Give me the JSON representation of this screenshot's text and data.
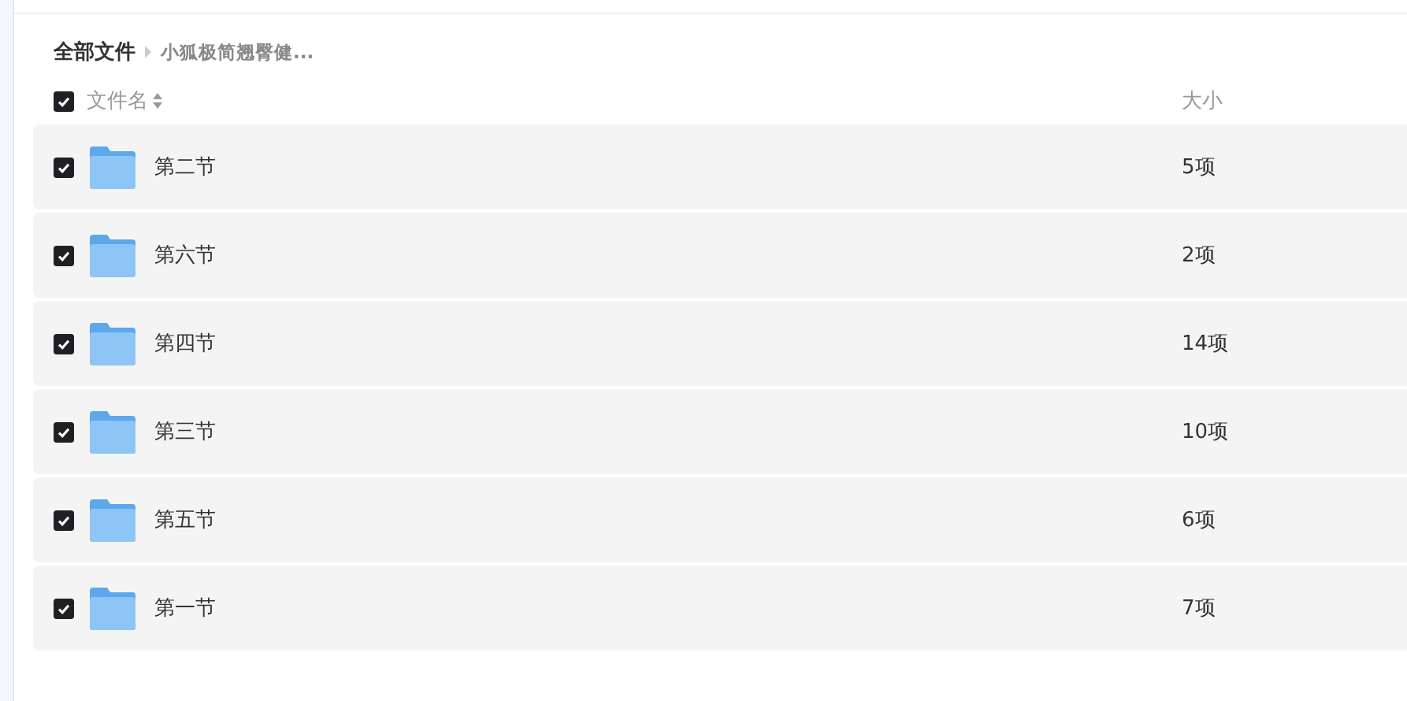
{
  "breadcrumb": [
    {
      "label": "全部文件",
      "kind": "root"
    },
    {
      "label": "小狐极简翘臀健...",
      "kind": "current"
    }
  ],
  "table": {
    "select_all": {
      "checked": true
    },
    "columns": [
      {
        "label": "文件名",
        "sortable": true
      },
      {
        "label": "大小",
        "sortable": false
      }
    ],
    "rows": [
      {
        "name": "第二节",
        "size": "5项",
        "selected": true
      },
      {
        "name": "第六节",
        "size": "2项",
        "selected": true
      },
      {
        "name": "第四节",
        "size": "14项",
        "selected": true
      },
      {
        "name": "第三节",
        "size": "10项",
        "selected": true
      },
      {
        "name": "第五节",
        "size": "6项",
        "selected": true
      },
      {
        "name": "第一节",
        "size": "7项",
        "selected": true
      }
    ]
  }
}
